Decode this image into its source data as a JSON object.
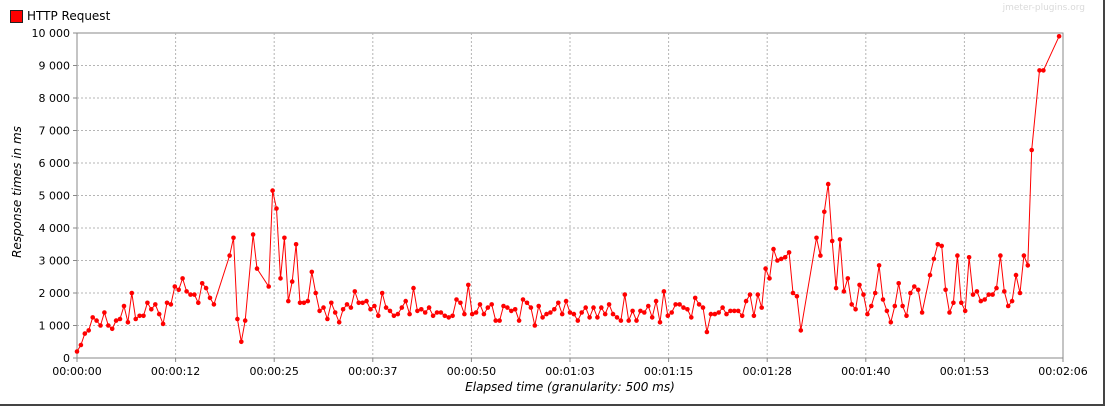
{
  "watermark": "jmeter-plugins.org",
  "chart_data": {
    "type": "line",
    "title": "",
    "xlabel": "Elapsed time (granularity: 500 ms)",
    "ylabel": "Response times in ms",
    "ylim": [
      0,
      10000
    ],
    "xlim": [
      0,
      126
    ],
    "y_ticks": [
      0,
      1000,
      2000,
      3000,
      4000,
      5000,
      6000,
      7000,
      8000,
      9000,
      10000
    ],
    "y_tick_labels": [
      "0",
      "1 000",
      "2 000",
      "3 000",
      "4 000",
      "5 000",
      "6 000",
      "7 000",
      "8 000",
      "9 000",
      "10 000"
    ],
    "x_ticks": [
      0,
      12.6,
      25.2,
      37.8,
      50.4,
      63,
      75.6,
      88.2,
      100.8,
      113.4,
      126
    ],
    "x_tick_labels": [
      "00:00:00",
      "00:00:12",
      "00:00:25",
      "00:00:37",
      "00:00:50",
      "00:01:03",
      "00:01:15",
      "00:01:28",
      "00:01:40",
      "00:01:53",
      "00:02:06"
    ],
    "grid": true,
    "legend_position": "top-left",
    "series": [
      {
        "name": "HTTP Request",
        "color": "#ff0000",
        "points": [
          [
            0,
            200
          ],
          [
            0.5,
            400
          ],
          [
            1,
            750
          ],
          [
            1.5,
            850
          ],
          [
            2,
            1250
          ],
          [
            2.5,
            1150
          ],
          [
            3,
            1000
          ],
          [
            3.5,
            1400
          ],
          [
            4,
            1000
          ],
          [
            4.5,
            900
          ],
          [
            5,
            1150
          ],
          [
            5.5,
            1200
          ],
          [
            6,
            1600
          ],
          [
            6.5,
            1100
          ],
          [
            7,
            2000
          ],
          [
            7.5,
            1200
          ],
          [
            8,
            1300
          ],
          [
            8.5,
            1300
          ],
          [
            9,
            1700
          ],
          [
            9.5,
            1500
          ],
          [
            10,
            1650
          ],
          [
            10.5,
            1350
          ],
          [
            11,
            1050
          ],
          [
            11.5,
            1700
          ],
          [
            12,
            1650
          ],
          [
            12.5,
            2200
          ],
          [
            13,
            2100
          ],
          [
            13.5,
            2450
          ],
          [
            14,
            2050
          ],
          [
            14.5,
            1950
          ],
          [
            15,
            1950
          ],
          [
            15.5,
            1700
          ],
          [
            16,
            2300
          ],
          [
            16.5,
            2150
          ],
          [
            17,
            1850
          ],
          [
            17.5,
            1650
          ],
          [
            19.5,
            3150
          ],
          [
            20,
            3700
          ],
          [
            20.5,
            1200
          ],
          [
            21,
            500
          ],
          [
            21.5,
            1150
          ],
          [
            22.5,
            3800
          ],
          [
            23,
            2750
          ],
          [
            24.5,
            2200
          ],
          [
            25,
            5150
          ],
          [
            25.5,
            4600
          ],
          [
            26,
            2450
          ],
          [
            26.5,
            3700
          ],
          [
            27,
            1750
          ],
          [
            27.5,
            2350
          ],
          [
            28,
            3500
          ],
          [
            28.5,
            1700
          ],
          [
            29,
            1700
          ],
          [
            29.5,
            1750
          ],
          [
            30,
            2650
          ],
          [
            30.5,
            2000
          ],
          [
            31,
            1450
          ],
          [
            31.5,
            1550
          ],
          [
            32,
            1200
          ],
          [
            32.5,
            1700
          ],
          [
            33,
            1400
          ],
          [
            33.5,
            1100
          ],
          [
            34,
            1500
          ],
          [
            34.5,
            1650
          ],
          [
            35,
            1550
          ],
          [
            35.5,
            2050
          ],
          [
            36,
            1700
          ],
          [
            36.5,
            1700
          ],
          [
            37,
            1750
          ],
          [
            37.5,
            1500
          ],
          [
            38,
            1600
          ],
          [
            38.5,
            1300
          ],
          [
            39,
            2000
          ],
          [
            39.5,
            1550
          ],
          [
            40,
            1450
          ],
          [
            40.5,
            1300
          ],
          [
            41,
            1350
          ],
          [
            41.5,
            1550
          ],
          [
            42,
            1750
          ],
          [
            42.5,
            1350
          ],
          [
            43,
            2150
          ],
          [
            43.5,
            1450
          ],
          [
            44,
            1500
          ],
          [
            44.5,
            1400
          ],
          [
            45,
            1550
          ],
          [
            45.5,
            1300
          ],
          [
            46,
            1400
          ],
          [
            46.5,
            1400
          ],
          [
            47,
            1300
          ],
          [
            47.5,
            1250
          ],
          [
            48,
            1300
          ],
          [
            48.5,
            1800
          ],
          [
            49,
            1700
          ],
          [
            49.5,
            1350
          ],
          [
            50,
            2250
          ],
          [
            50.5,
            1350
          ],
          [
            51,
            1400
          ],
          [
            51.5,
            1650
          ],
          [
            52,
            1350
          ],
          [
            52.5,
            1550
          ],
          [
            53,
            1650
          ],
          [
            53.5,
            1150
          ],
          [
            54,
            1150
          ],
          [
            54.5,
            1600
          ],
          [
            55,
            1550
          ],
          [
            55.5,
            1450
          ],
          [
            56,
            1500
          ],
          [
            56.5,
            1150
          ],
          [
            57,
            1800
          ],
          [
            57.5,
            1700
          ],
          [
            58,
            1550
          ],
          [
            58.5,
            1000
          ],
          [
            59,
            1600
          ],
          [
            59.5,
            1250
          ],
          [
            60,
            1350
          ],
          [
            60.5,
            1400
          ],
          [
            61,
            1500
          ],
          [
            61.5,
            1700
          ],
          [
            62,
            1350
          ],
          [
            62.5,
            1750
          ],
          [
            63,
            1400
          ],
          [
            63.5,
            1350
          ],
          [
            64,
            1150
          ],
          [
            64.5,
            1400
          ],
          [
            65,
            1550
          ],
          [
            65.5,
            1250
          ],
          [
            66,
            1550
          ],
          [
            66.5,
            1250
          ],
          [
            67,
            1550
          ],
          [
            67.5,
            1350
          ],
          [
            68,
            1650
          ],
          [
            68.5,
            1350
          ],
          [
            69,
            1250
          ],
          [
            69.5,
            1150
          ],
          [
            70,
            1950
          ],
          [
            70.5,
            1150
          ],
          [
            71,
            1450
          ],
          [
            71.5,
            1150
          ],
          [
            72,
            1450
          ],
          [
            72.5,
            1400
          ],
          [
            73,
            1600
          ],
          [
            73.5,
            1250
          ],
          [
            74,
            1750
          ],
          [
            74.5,
            1100
          ],
          [
            75,
            2050
          ],
          [
            75.5,
            1300
          ],
          [
            76,
            1400
          ],
          [
            76.5,
            1650
          ],
          [
            77,
            1650
          ],
          [
            77.5,
            1550
          ],
          [
            78,
            1500
          ],
          [
            78.5,
            1250
          ],
          [
            79,
            1850
          ],
          [
            79.5,
            1650
          ],
          [
            80,
            1550
          ],
          [
            80.5,
            800
          ],
          [
            81,
            1350
          ],
          [
            81.5,
            1350
          ],
          [
            82,
            1400
          ],
          [
            82.5,
            1550
          ],
          [
            83,
            1350
          ],
          [
            83.5,
            1450
          ],
          [
            84,
            1450
          ],
          [
            84.5,
            1450
          ],
          [
            85,
            1300
          ],
          [
            85.5,
            1750
          ],
          [
            86,
            1950
          ],
          [
            86.5,
            1300
          ],
          [
            87,
            1950
          ],
          [
            87.5,
            1550
          ],
          [
            88,
            2750
          ],
          [
            88.5,
            2450
          ],
          [
            89,
            3350
          ],
          [
            89.5,
            3000
          ],
          [
            90,
            3050
          ],
          [
            90.5,
            3100
          ],
          [
            91,
            3250
          ],
          [
            91.5,
            2000
          ],
          [
            92,
            1900
          ],
          [
            92.5,
            850
          ],
          [
            94.5,
            3700
          ],
          [
            95,
            3150
          ],
          [
            95.5,
            4500
          ],
          [
            96,
            5350
          ],
          [
            96.5,
            3600
          ],
          [
            97,
            2150
          ],
          [
            97.5,
            3650
          ],
          [
            98,
            2050
          ],
          [
            98.5,
            2450
          ],
          [
            99,
            1650
          ],
          [
            99.5,
            1500
          ],
          [
            100,
            2250
          ],
          [
            100.5,
            1950
          ],
          [
            101,
            1350
          ],
          [
            101.5,
            1600
          ],
          [
            102,
            2000
          ],
          [
            102.5,
            2850
          ],
          [
            103,
            1800
          ],
          [
            103.5,
            1450
          ],
          [
            104,
            1100
          ],
          [
            104.5,
            1600
          ],
          [
            105,
            2300
          ],
          [
            105.5,
            1600
          ],
          [
            106,
            1300
          ],
          [
            106.5,
            2000
          ],
          [
            107,
            2200
          ],
          [
            107.5,
            2100
          ],
          [
            108,
            1400
          ],
          [
            109,
            2550
          ],
          [
            109.5,
            3050
          ],
          [
            110,
            3500
          ],
          [
            110.5,
            3450
          ],
          [
            111,
            2100
          ],
          [
            111.5,
            1400
          ],
          [
            112,
            1700
          ],
          [
            112.5,
            3150
          ],
          [
            113,
            1700
          ],
          [
            113.5,
            1450
          ],
          [
            114,
            3100
          ],
          [
            114.5,
            1950
          ],
          [
            115,
            2050
          ],
          [
            115.5,
            1750
          ],
          [
            116,
            1800
          ],
          [
            116.5,
            1950
          ],
          [
            117,
            1950
          ],
          [
            117.5,
            2150
          ],
          [
            118,
            3150
          ],
          [
            118.5,
            2050
          ],
          [
            119,
            1600
          ],
          [
            119.5,
            1750
          ],
          [
            120,
            2550
          ],
          [
            120.5,
            2000
          ],
          [
            121,
            3150
          ],
          [
            121.5,
            2850
          ],
          [
            122,
            6400
          ],
          [
            123,
            8850
          ],
          [
            123.5,
            8850
          ],
          [
            125.5,
            9900
          ]
        ]
      }
    ]
  }
}
